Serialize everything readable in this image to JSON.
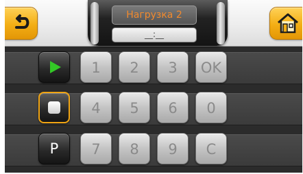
{
  "header": {
    "back_icon": "back-arrow-icon",
    "home_icon": "home-icon",
    "title": "Нагрузка 2",
    "time_value": "__:__"
  },
  "keypad": {
    "keys": [
      "1",
      "2",
      "3",
      "OK",
      "4",
      "5",
      "6",
      "0",
      "7",
      "8",
      "9",
      "C"
    ]
  },
  "controls": {
    "play_icon": "play-icon",
    "stop_icon": "stop-icon",
    "p_label": "P"
  },
  "colors": {
    "accent": "#f3ae15",
    "title_text": "#f28a2d",
    "play": "#33c826"
  }
}
